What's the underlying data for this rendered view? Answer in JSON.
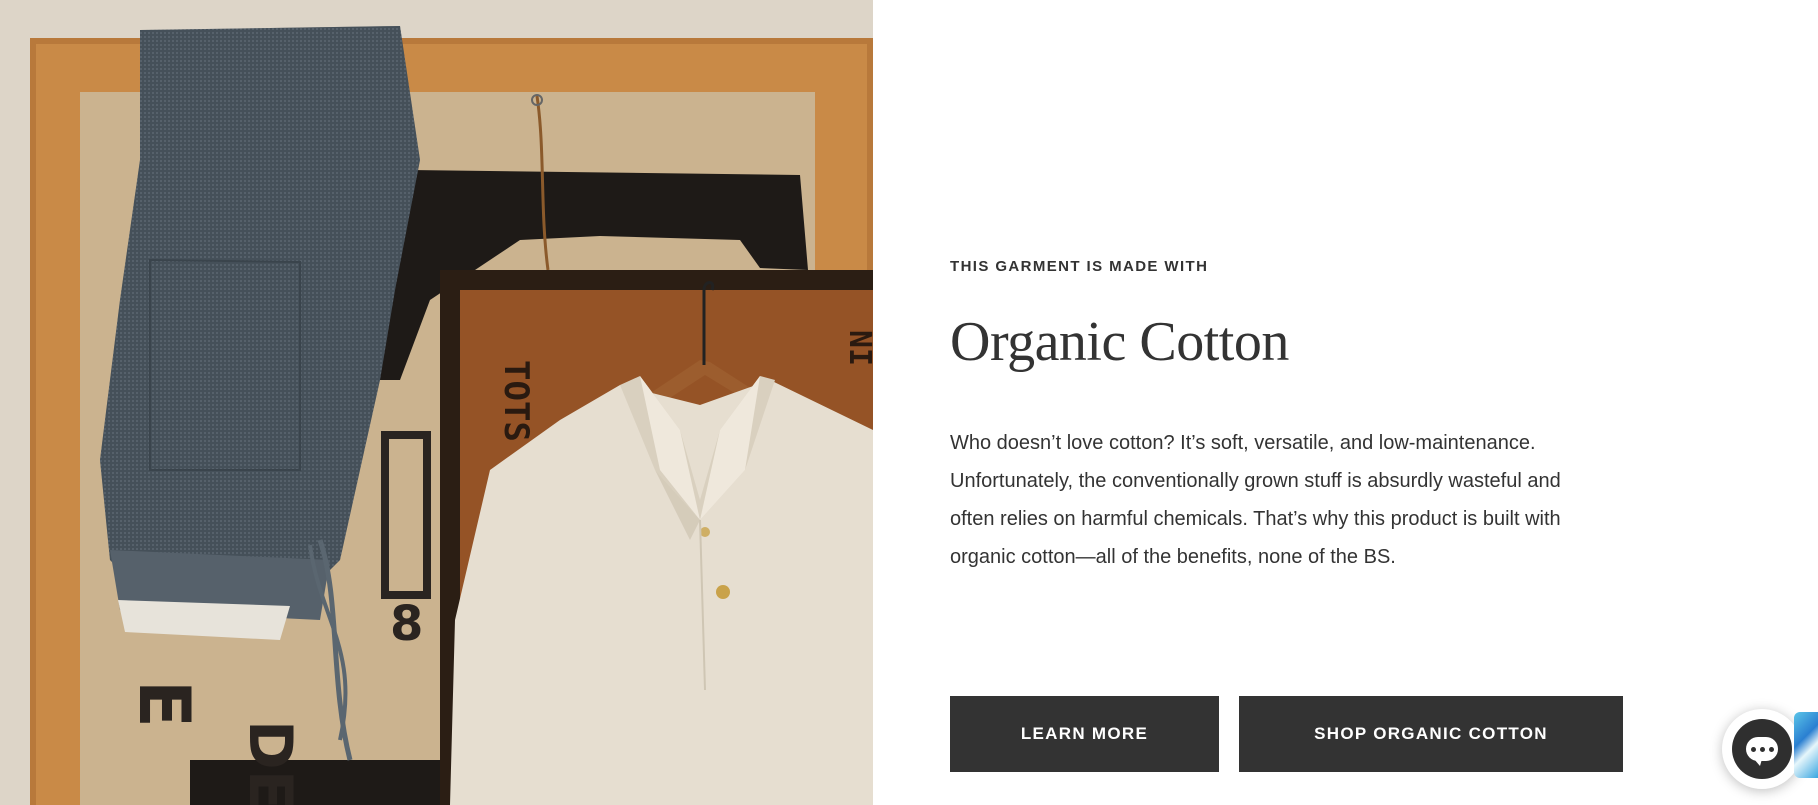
{
  "hero": {
    "image_alt": "Folded indigo pants and a cream polo shirt on a wooden hanger against wooden frames"
  },
  "section": {
    "eyebrow": "THIS GARMENT IS MADE WITH",
    "title": "Organic Cotton",
    "body": "Who doesn’t love cotton? It’s soft, versatile, and low-maintenance. Unfortunately, the conventionally grown stuff is absurdly wasteful and often relies on harmful chemicals. That’s why this product is built with organic cotton—all of the benefits, none of the BS."
  },
  "buttons": {
    "learn_more": "LEARN MORE",
    "shop": "SHOP ORGANIC COTTON"
  },
  "chat": {
    "icon": "chat-icon"
  },
  "colors": {
    "button_bg": "#333333",
    "text": "#333333",
    "background": "#ffffff"
  }
}
